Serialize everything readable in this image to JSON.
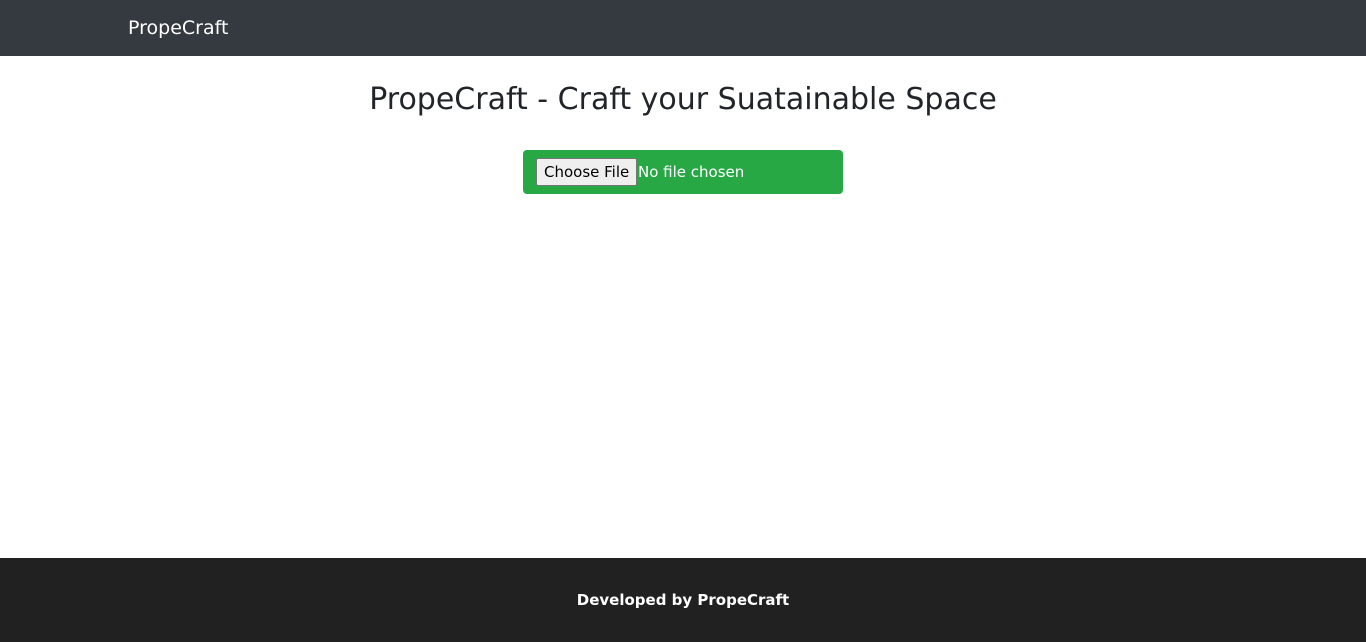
{
  "navbar": {
    "brand": "PropeCraft",
    "background": "#343a40"
  },
  "main": {
    "title": "PropeCraft - Craft your Suatainable Space",
    "upload": {
      "button_label": "Choose File",
      "status": "No file chosen",
      "background": "#28a745"
    }
  },
  "footer": {
    "text": "Developed by PropeCraft",
    "background": "#212121"
  }
}
